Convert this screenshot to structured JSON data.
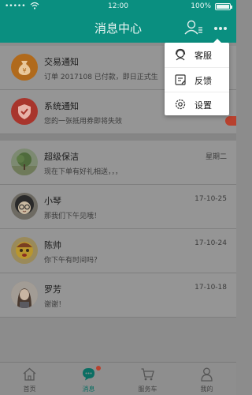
{
  "status_bar": {
    "carrier": "•••••",
    "time": "12:00",
    "battery": "100%"
  },
  "header": {
    "title": "消息中心",
    "contacts_icon": "contacts-icon",
    "more_icon": "more-dots-icon"
  },
  "messages": [
    {
      "name": "交易通知",
      "preview": "订单 2017108 已付款，即日正式生",
      "time": "",
      "avatar_icon": "money-bag-icon",
      "avatar_color": "#b06a1c"
    },
    {
      "name": "系统通知",
      "preview": "您的一张抵用券即将失效",
      "time": "",
      "avatar_icon": "shield-icon",
      "avatar_color": "#a8352c"
    },
    {
      "name": "超级保洁",
      "preview": "现在下单有好礼相送，，，",
      "time": "星期二",
      "avatar_icon": "tree-photo"
    },
    {
      "name": "小琴",
      "preview": "那我们下午见哦！",
      "time": "17-10-25",
      "avatar_icon": "cartoon-girl-photo"
    },
    {
      "name": "陈帅",
      "preview": "你下午有时间吗？",
      "time": "17-10-24",
      "avatar_icon": "cartoon-face-photo"
    },
    {
      "name": "罗芳",
      "preview": "谢谢！",
      "time": "17-10-18",
      "avatar_icon": "woman-photo"
    }
  ],
  "dropdown_menu": [
    {
      "label": "客服",
      "icon": "customer-service-icon"
    },
    {
      "label": "反馈",
      "icon": "feedback-icon"
    },
    {
      "label": "设置",
      "icon": "settings-gear-icon"
    }
  ],
  "tabs": [
    {
      "label": "首页",
      "icon": "home-icon",
      "active": false
    },
    {
      "label": "消息",
      "icon": "chat-icon",
      "active": true,
      "has_dot": true
    },
    {
      "label": "服务车",
      "icon": "cart-icon",
      "active": false
    },
    {
      "label": "我的",
      "icon": "person-icon",
      "active": false
    }
  ],
  "colors": {
    "brand": "#0a8f80",
    "badge": "#b8412e",
    "overlay_bg": "#8c8c8c"
  }
}
